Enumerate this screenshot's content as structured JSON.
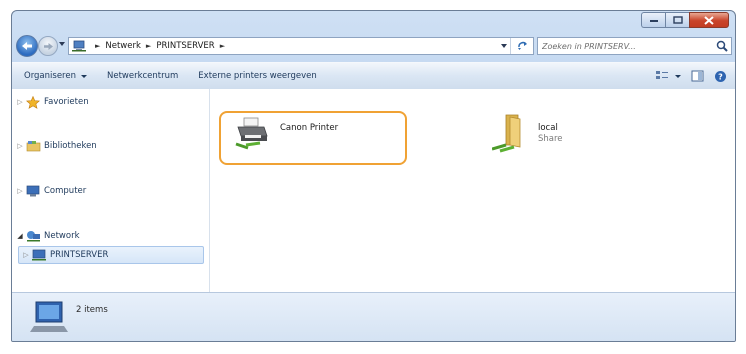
{
  "address": {
    "crumbs": [
      "Netwerk",
      "PRINTSERVER"
    ]
  },
  "search": {
    "placeholder": "Zoeken in PRINTSERV..."
  },
  "toolbar": {
    "organize_label": "Organiseren",
    "network_center_label": "Netwerkcentrum",
    "external_printers_label": "Externe printers weergeven"
  },
  "navpane": {
    "favorites": "Favorieten",
    "libraries": "Bibliotheken",
    "computer": "Computer",
    "network": "Network",
    "printserver": "PRINTSERVER"
  },
  "files": [
    {
      "name": "Canon Printer",
      "sub": "",
      "icon": "printer-icon"
    },
    {
      "name": "local",
      "sub": "Share",
      "icon": "shared-folder-icon"
    }
  ],
  "details": {
    "count": "2 items"
  },
  "colors": {
    "highlight": "#f0a234",
    "window_frame": "#bcd3ee",
    "close_button": "#c9442a"
  }
}
